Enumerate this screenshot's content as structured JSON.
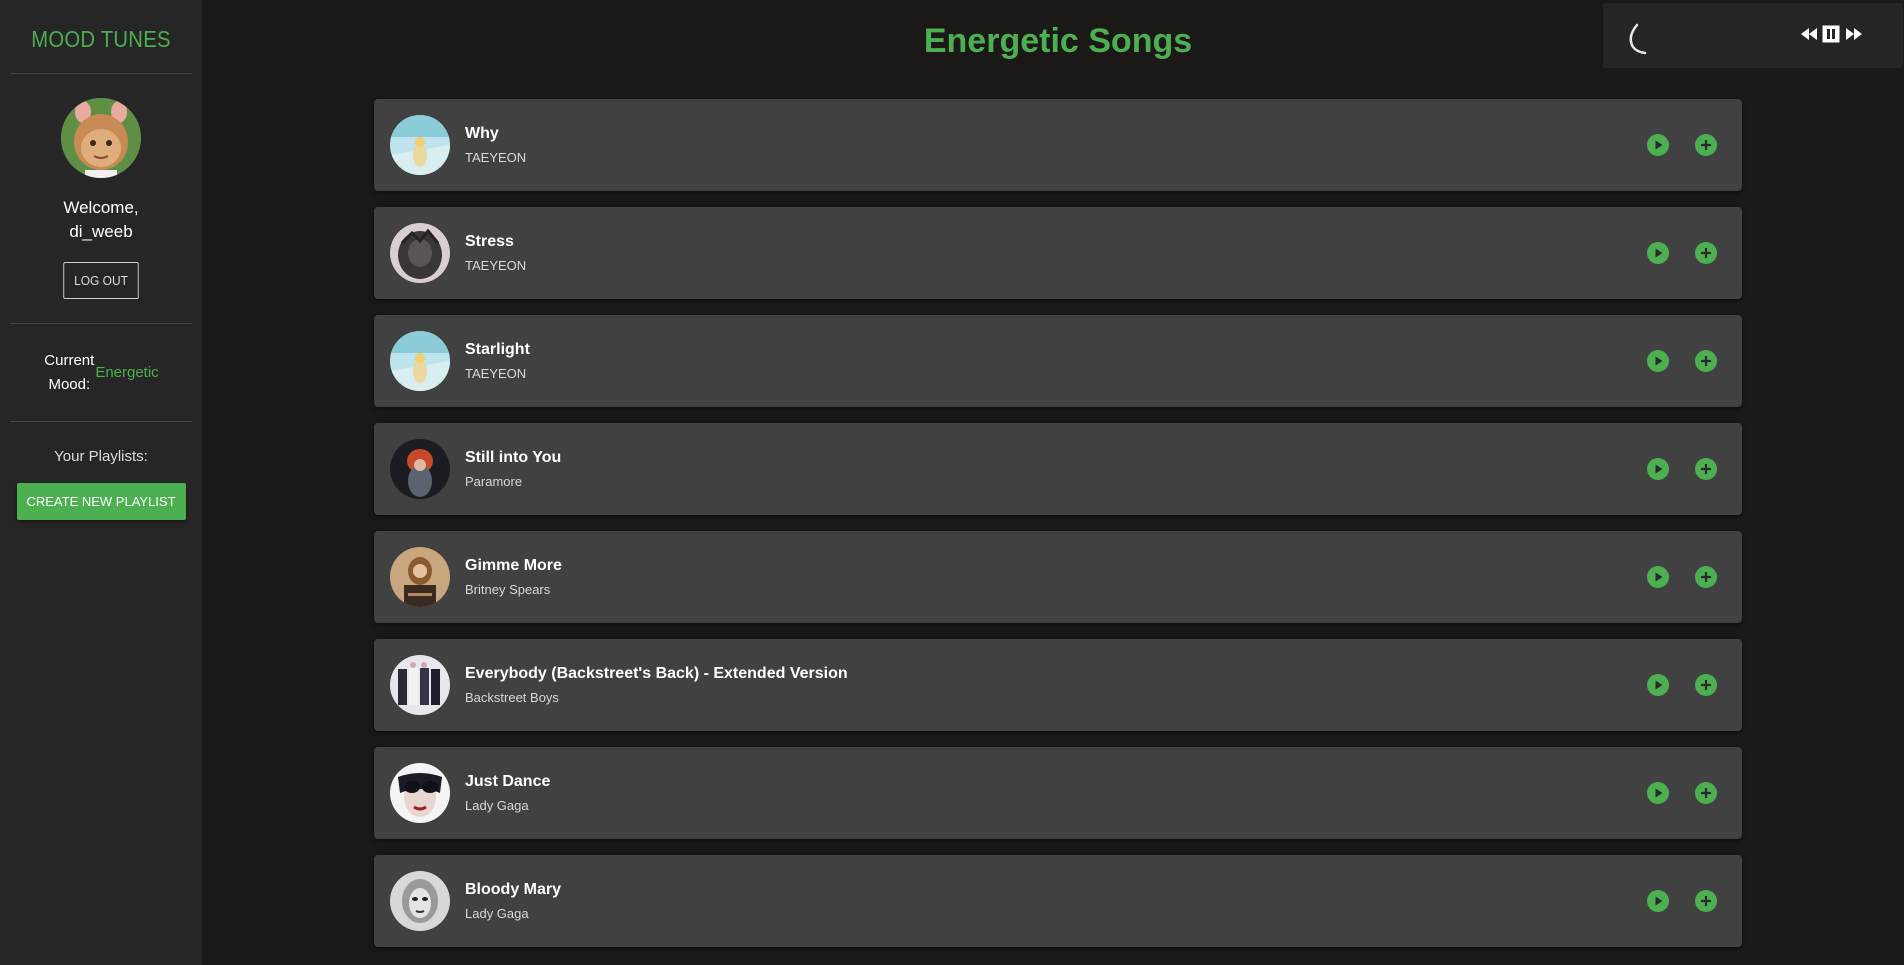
{
  "sidebar": {
    "brand": "MOOD TUNES",
    "welcome_line1": "Welcome,",
    "welcome_line2": "di_weeb",
    "logout_label": "LOG OUT",
    "mood_label": "Current Mood:",
    "mood_value": "Energetic",
    "playlists_label": "Your Playlists:",
    "create_playlist_label": "CREATE NEW PLAYLIST"
  },
  "main": {
    "title": "Energetic Songs",
    "songs": [
      {
        "title": "Why",
        "artist": "TAEYEON"
      },
      {
        "title": "Stress",
        "artist": "TAEYEON"
      },
      {
        "title": "Starlight",
        "artist": "TAEYEON"
      },
      {
        "title": "Still into You",
        "artist": "Paramore"
      },
      {
        "title": "Gimme More",
        "artist": "Britney Spears"
      },
      {
        "title": "Everybody (Backstreet's Back) - Extended Version",
        "artist": "Backstreet Boys"
      },
      {
        "title": "Just Dance",
        "artist": "Lady Gaga"
      },
      {
        "title": "Bloody Mary",
        "artist": "Lady Gaga"
      }
    ]
  },
  "player": {
    "state": "loading",
    "controls": [
      "rewind-icon",
      "pause-icon",
      "fast-forward-icon"
    ]
  },
  "colors": {
    "accent": "#4caf50",
    "background": "#1b1918",
    "sidebar": "#262626",
    "card": "#414141"
  }
}
